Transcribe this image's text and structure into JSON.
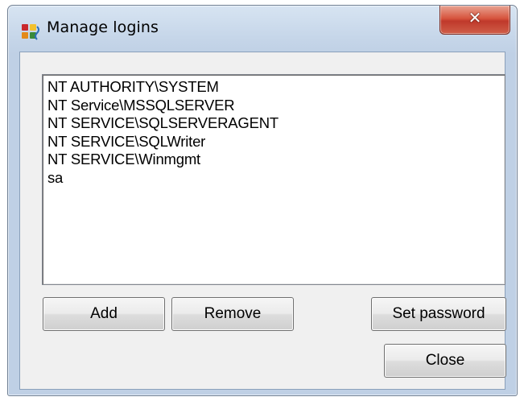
{
  "window": {
    "title": "Manage logins",
    "icon": "sql-server-icon",
    "close_glyph": "✕"
  },
  "logins": {
    "items": [
      "NT AUTHORITY\\SYSTEM",
      "NT Service\\MSSQLSERVER",
      "NT SERVICE\\SQLSERVERAGENT",
      "NT SERVICE\\SQLWriter",
      "NT SERVICE\\Winmgmt",
      "sa"
    ]
  },
  "buttons": {
    "add": "Add",
    "remove": "Remove",
    "set_password": "Set password",
    "close": "Close"
  },
  "colors": {
    "close_button": "#c0392b",
    "frame": "#bfd0e5"
  }
}
